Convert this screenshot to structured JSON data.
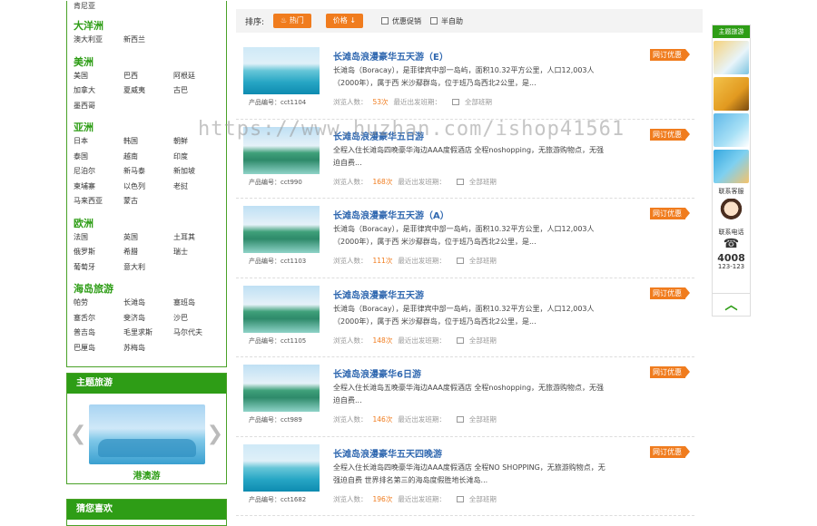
{
  "sidebar": {
    "top_item": "肯尼亚",
    "regions": [
      {
        "name": "大洋洲",
        "cities": [
          "澳大利亚",
          "新西兰"
        ]
      },
      {
        "name": "美洲",
        "cities": [
          "美国",
          "巴西",
          "阿根廷",
          "加拿大",
          "夏威夷",
          "古巴",
          "墨西哥"
        ]
      },
      {
        "name": "亚洲",
        "cities": [
          "日本",
          "韩国",
          "朝鲜",
          "泰国",
          "越南",
          "印度",
          "尼泊尔",
          "新马泰",
          "新加坡",
          "柬埔寨",
          "以色列",
          "老挝",
          "马来西亚",
          "蒙古"
        ]
      },
      {
        "name": "欧洲",
        "cities": [
          "法国",
          "英国",
          "土耳其",
          "俄罗斯",
          "希腊",
          "瑞士",
          "葡萄牙",
          "意大利"
        ]
      },
      {
        "name": "海岛旅游",
        "cities": [
          "帕劳",
          "长滩岛",
          "塞班岛",
          "塞舌尔",
          "斐济岛",
          "沙巴",
          "普吉岛",
          "毛里求斯",
          "马尔代夫",
          "巴厘岛",
          "苏梅岛"
        ]
      }
    ],
    "theme_panel": {
      "title": "主题旅游",
      "caption": "港澳游",
      "prev": "❮",
      "next": "❯"
    },
    "guess_panel": {
      "title": "猜您喜欢"
    }
  },
  "sortbar": {
    "label": "排序:",
    "buttons": [
      {
        "label": "热门",
        "icon": "flame-icon"
      },
      {
        "label": "价格",
        "icon": "arrow-down-icon"
      }
    ],
    "checkboxes": [
      "优惠促销",
      "半自助"
    ]
  },
  "products": [
    {
      "title": "长滩岛浪漫豪华五天游（E）",
      "desc": "长滩岛（Boracay），是菲律宾中部一岛屿，面积10.32平方公里，人口12,003人（2000年），属于西 米沙鄢群岛，位于班乃岛西北2公里，是...",
      "code": "产品编号：cct1104",
      "views_label": "浏览人数：",
      "views": "53次",
      "depart_label": "最近出发班期：",
      "depart": "全部班期",
      "badge": "网订优惠",
      "thumb": "boat"
    },
    {
      "title": "长滩岛浪漫豪华五日游",
      "desc": "全程入住长滩岛四晚豪华海边AAA度假酒店 全程noshopping，无旅游购物点，无强迫自费...",
      "code": "产品编号：cct990",
      "views_label": "浏览人数：",
      "views": "168次",
      "depart_label": "最近出发班期：",
      "depart": "全部班期",
      "badge": "网订优惠",
      "thumb": "island"
    },
    {
      "title": "长滩岛浪漫豪华五天游（A）",
      "desc": "长滩岛（Boracay），是菲律宾中部一岛屿，面积10.32平方公里，人口12,003人（2000年），属于西 米沙鄢群岛，位于班乃岛西北2公里，是...",
      "code": "产品编号：cct1103",
      "views_label": "浏览人数：",
      "views": "111次",
      "depart_label": "最近出发班期：",
      "depart": "全部班期",
      "badge": "网订优惠",
      "thumb": "cliff"
    },
    {
      "title": "长滩岛浪漫豪华五天游",
      "desc": "长滩岛（Boracay），是菲律宾中部一岛屿，面积10.32平方公里，人口12,003人（2000年），属于西 米沙鄢群岛，位于班乃岛西北2公里，是...",
      "code": "产品编号：cct1105",
      "views_label": "浏览人数：",
      "views": "148次",
      "depart_label": "最近出发班期：",
      "depart": "全部班期",
      "badge": "网订优惠",
      "thumb": "cliff"
    },
    {
      "title": "长滩岛浪漫豪华6日游",
      "desc": "全程入住长滩岛五晚豪华海边AAA度假酒店 全程noshopping，无旅游购物点，无强迫自费...",
      "code": "产品编号：cct989",
      "views_label": "浏览人数：",
      "views": "146次",
      "depart_label": "最近出发班期：",
      "depart": "全部班期",
      "badge": "网订优惠",
      "thumb": "cliff"
    },
    {
      "title": "长滩岛浪漫豪华五天四晚游",
      "desc": "全程入住长滩岛四晚豪华海边AAA度假酒店 全程NO SHOPPING，无旅游购物点，无强迫自费 世界排名第三的海岛度假胜地长滩岛...",
      "code": "产品编号：cct1682",
      "views_label": "浏览人数：",
      "views": "196次",
      "depart_label": "最近出发班期：",
      "depart": "全部班期",
      "badge": "网订优惠",
      "thumb": "coast"
    }
  ],
  "rightbar": {
    "head": "主题旅游",
    "service": "联系客服",
    "phone_label": "联系电话",
    "phone_main": "4008",
    "phone_sub": "123-123"
  },
  "watermark": "https://www.huzhan.com/ishop41561",
  "colors": {
    "green": "#2e9d16",
    "orange": "#f07c1e",
    "title_blue": "#3068b0"
  }
}
